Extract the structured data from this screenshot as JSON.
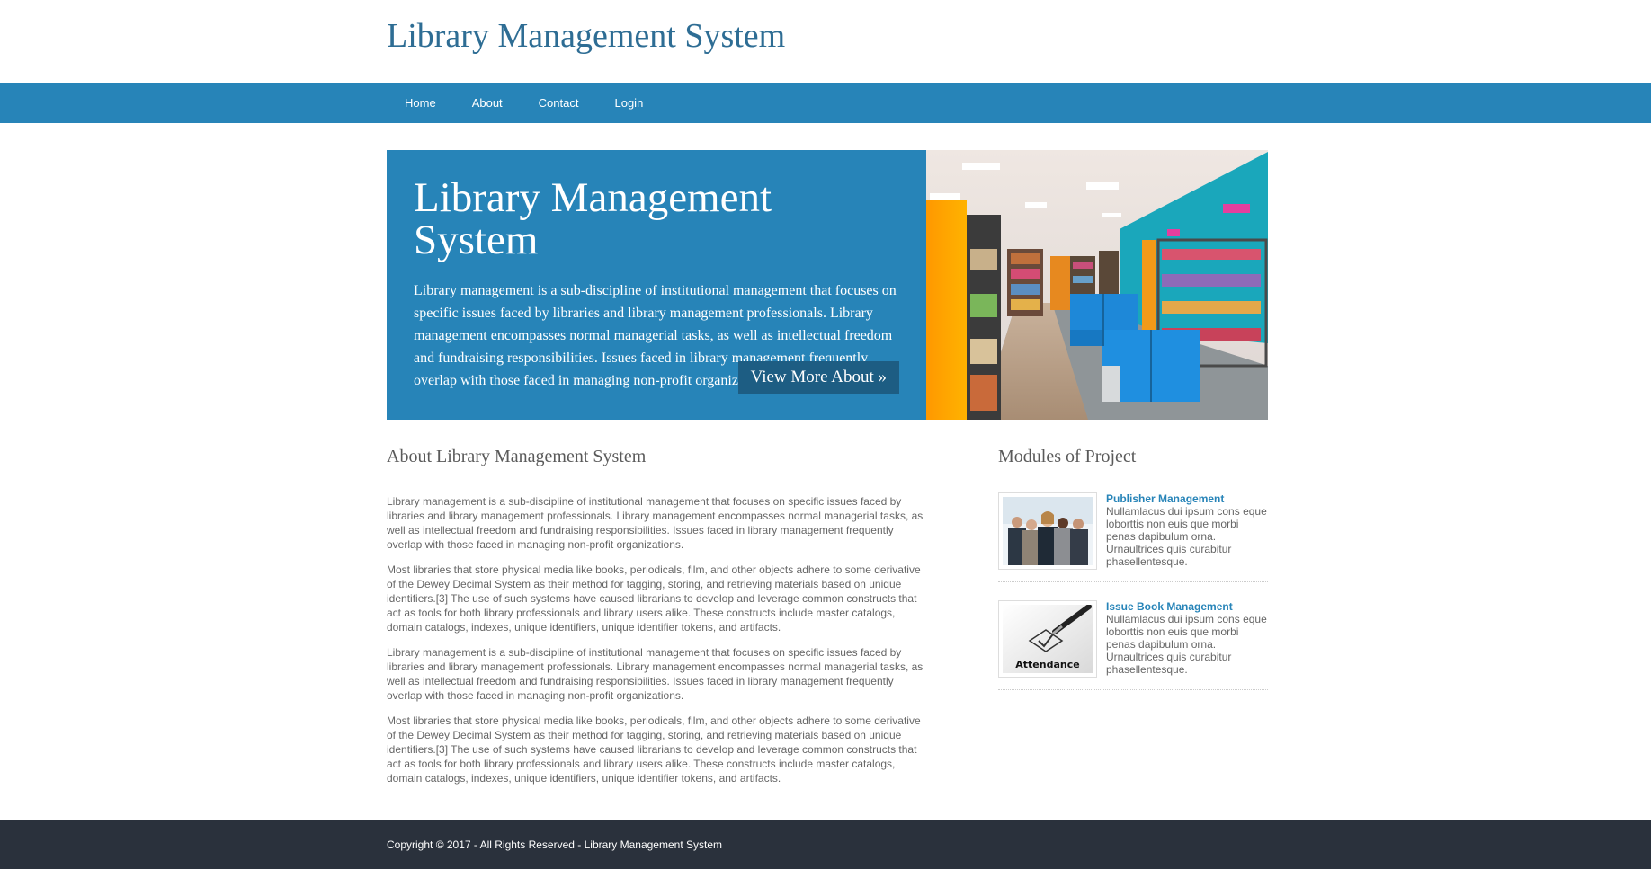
{
  "header": {
    "title": "Library Management System"
  },
  "nav": {
    "items": [
      {
        "label": "Home"
      },
      {
        "label": "About"
      },
      {
        "label": "Contact"
      },
      {
        "label": "Login"
      }
    ]
  },
  "hero": {
    "title": "Library Management System",
    "description": "Library management is a sub-discipline of institutional management that focuses on specific issues faced by libraries and library management professionals. Library management encompasses normal managerial tasks, as well as intellectual freedom and fundraising responsibilities. Issues faced in library management frequently overlap with those faced in managing non-profit organizations.",
    "button_label": "View More About »",
    "image_alt": "library interior with bookshelves and blue chairs"
  },
  "about": {
    "title": "About Library Management System",
    "paragraphs": [
      "Library management is a sub-discipline of institutional management that focuses on specific issues faced by libraries and library management professionals. Library management encompasses normal managerial tasks, as well as intellectual freedom and fundraising responsibilities. Issues faced in library management frequently overlap with those faced in managing non-profit organizations.",
      "Most libraries that store physical media like books, periodicals, film, and other objects adhere to some derivative of the Dewey Decimal System as their method for tagging, storing, and retrieving materials based on unique identifiers.[3] The use of such systems have caused librarians to develop and leverage common constructs that act as tools for both library professionals and library users alike. These constructs include master catalogs, domain catalogs, indexes, unique identifiers, unique identifier tokens, and artifacts.",
      "Library management is a sub-discipline of institutional management that focuses on specific issues faced by libraries and library management professionals. Library management encompasses normal managerial tasks, as well as intellectual freedom and fundraising responsibilities. Issues faced in library management frequently overlap with those faced in managing non-profit organizations.",
      "Most libraries that store physical media like books, periodicals, film, and other objects adhere to some derivative of the Dewey Decimal System as their method for tagging, storing, and retrieving materials based on unique identifiers.[3] The use of such systems have caused librarians to develop and leverage common constructs that act as tools for both library professionals and library users alike. These constructs include master catalogs, domain catalogs, indexes, unique identifiers, unique identifier tokens, and artifacts."
    ]
  },
  "modules": {
    "title": "Modules of Project",
    "items": [
      {
        "title": "Publisher Management",
        "description": "Nullamlacus dui ipsum cons eque loborttis non euis que morbi penas dapibulum orna. Urnaultrices quis curabitur phasellentesque.",
        "image": "business-team-photo"
      },
      {
        "title": "Issue Book Management",
        "description": "Nullamlacus dui ipsum cons eque loborttis non euis que morbi penas dapibulum orna. Urnaultrices quis curabitur phasellentesque.",
        "image": "attendance-checkbox-photo",
        "image_caption": "Attendance"
      }
    ]
  },
  "footer": {
    "text": "Copyright © 2017 - All Rights Reserved - Library Management System"
  },
  "colors": {
    "brand_blue": "#2784b8",
    "button_dark": "#1d5d83",
    "title_blue": "#2e6d94",
    "footer_bg": "#2a313c"
  }
}
